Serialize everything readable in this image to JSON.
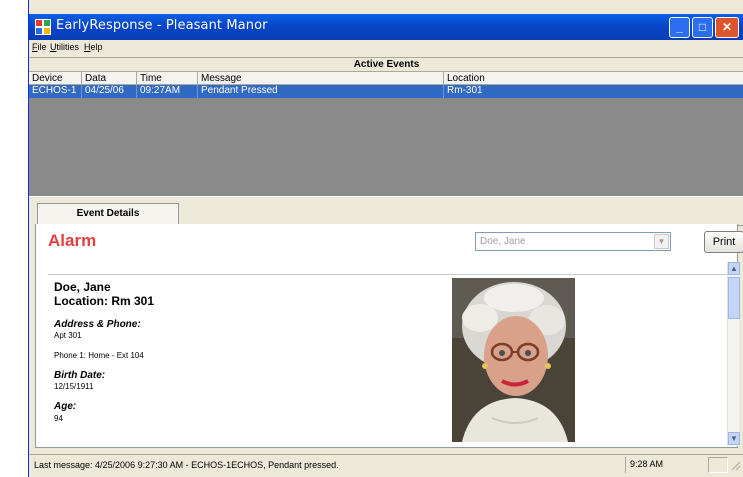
{
  "window": {
    "title": "EarlyResponse - Pleasant Manor"
  },
  "menu": [
    {
      "label": "File",
      "u": "F"
    },
    {
      "label": "Utilities",
      "u": "U"
    },
    {
      "label": "Help",
      "u": "H"
    }
  ],
  "events": {
    "header": "Active Events",
    "columns": [
      "Device",
      "Data",
      "Time",
      "Message",
      "Location"
    ],
    "rows": [
      [
        "ECHOS-1",
        "04/25/06",
        "09:27AM",
        "Pendant Pressed",
        "Rm-301"
      ]
    ]
  },
  "tab": {
    "label": "Event Details"
  },
  "details": {
    "alarm": "Alarm",
    "resident_select": "Doe, Jane",
    "print_label": "Print",
    "name": "Doe, Jane",
    "location": "Location: Rm 301",
    "address_label": "Address & Phone:",
    "address_value": "Apt 301",
    "phone": "Phone 1: Home - Ext 104",
    "birth_label": "Birth Date:",
    "birth_value": "12/15/1911",
    "age_label": "Age:",
    "age_value": "94"
  },
  "status": {
    "message": "Last message: 4/25/2006 9:27:30 AM  -  ECHOS-1ECHOS, Pendant pressed.",
    "time": "9:28 AM"
  },
  "colors": {
    "alarm": "#e43f3f",
    "selection": "#316ac5",
    "titlebar": "#0846c8"
  }
}
